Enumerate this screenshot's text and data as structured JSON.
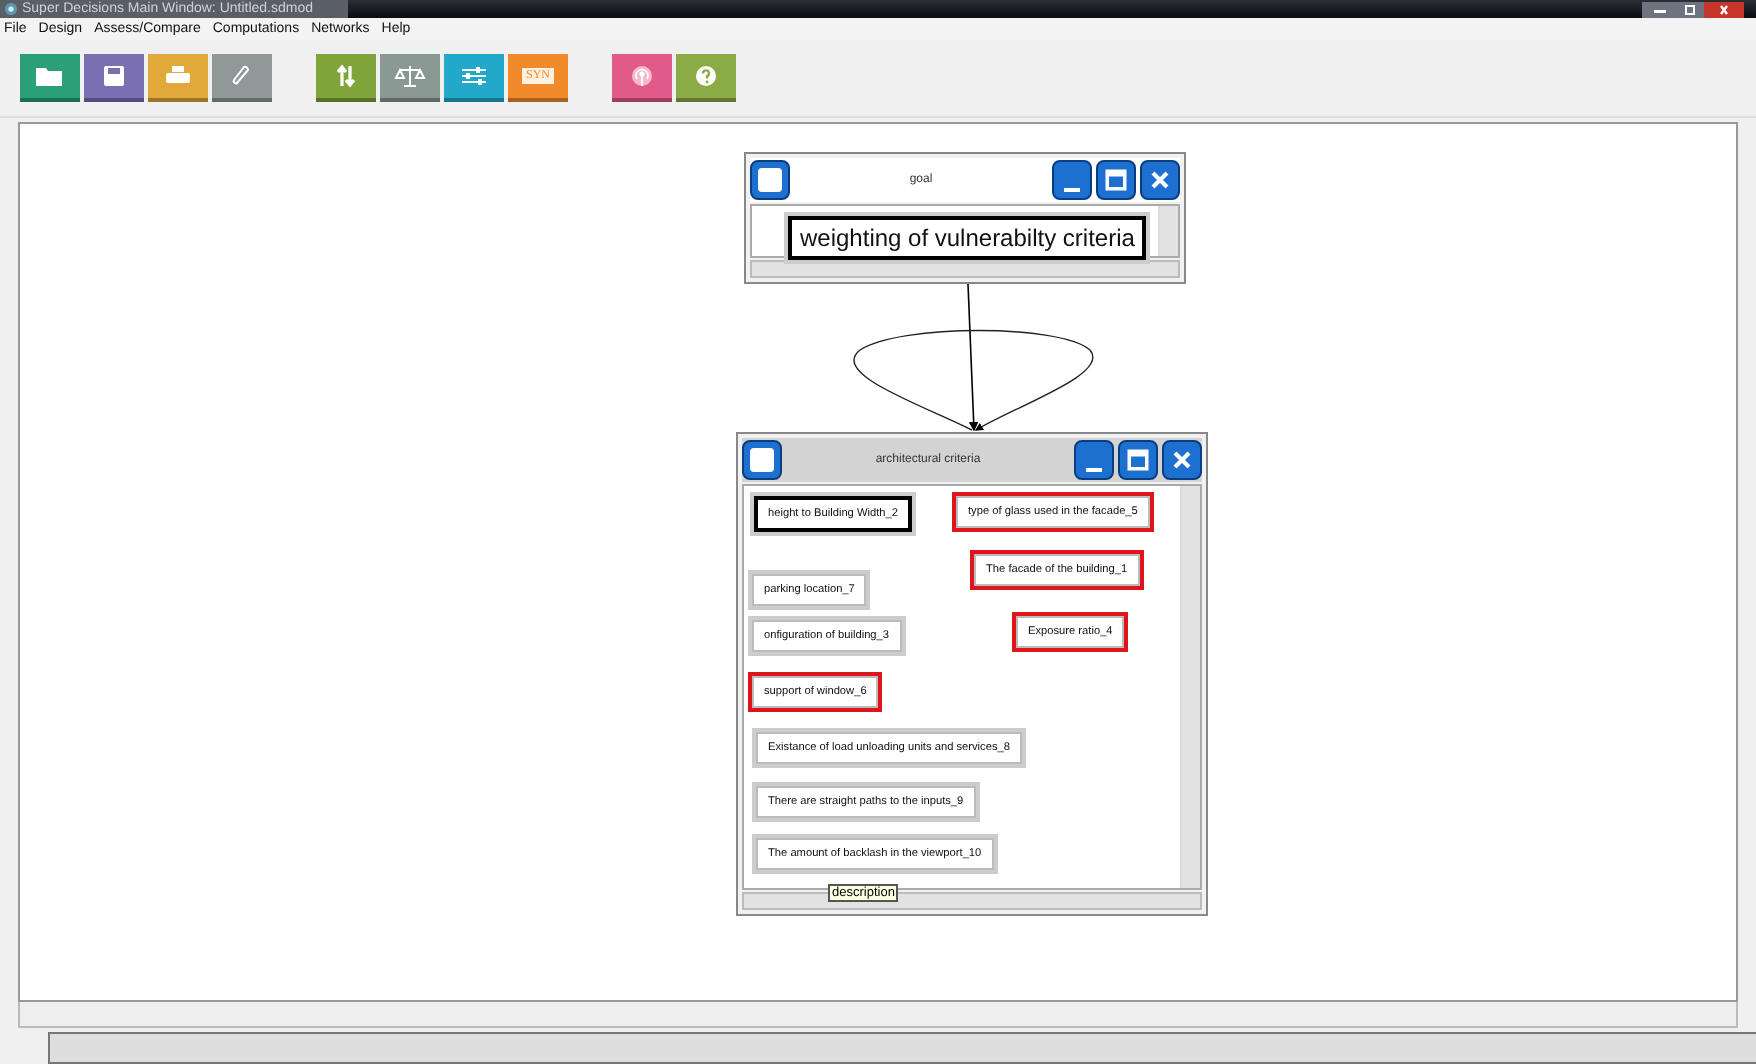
{
  "window": {
    "title": "Super Decisions Main Window: Untitled.sdmod"
  },
  "menu": [
    "File",
    "Design",
    "Assess/Compare",
    "Computations",
    "Networks",
    "Help"
  ],
  "toolbar": [
    {
      "kind": "folder",
      "color": "#2a9f78"
    },
    {
      "kind": "save",
      "color": "#7a6fb0"
    },
    {
      "kind": "print",
      "color": "#e0a93a"
    },
    {
      "kind": "clip",
      "color": "#8f9a98"
    },
    {
      "kind": "arrows",
      "color": "#7fa53a"
    },
    {
      "kind": "scale",
      "color": "#8a9893"
    },
    {
      "kind": "sliders",
      "color": "#22a9c9"
    },
    {
      "kind": "syn",
      "color": "#f08a2a",
      "label": "SYN"
    },
    {
      "kind": "podcast",
      "color": "#e05a8a"
    },
    {
      "kind": "help",
      "color": "#8aab45"
    }
  ],
  "clusters": [
    {
      "title": "goal",
      "active": false,
      "nodes": [
        {
          "label": "weighting of vulnerabilty criteria",
          "selected": false,
          "current": true
        }
      ]
    },
    {
      "title": "architectural criteria",
      "active": true,
      "tooltip": "description",
      "nodes": [
        {
          "label": "height  to Building Width_2",
          "selected": false,
          "current": true
        },
        {
          "label": "type of glass used in the facade_5",
          "selected": true,
          "current": false
        },
        {
          "label": "The facade of the building_1",
          "selected": true,
          "current": false
        },
        {
          "label": "parking location_7",
          "selected": false,
          "current": false
        },
        {
          "label": "onfiguration of building_3",
          "selected": false,
          "current": false
        },
        {
          "label": "Exposure ratio_4",
          "selected": true,
          "current": false
        },
        {
          "label": "support of window_6",
          "selected": true,
          "current": false
        },
        {
          "label": "Existance of load unloading units and services_8",
          "selected": false,
          "current": false
        },
        {
          "label": "There are straight paths to the inputs_9",
          "selected": false,
          "current": false
        },
        {
          "label": "The amount of backlash in the viewport_10",
          "selected": false,
          "current": false
        }
      ]
    }
  ]
}
